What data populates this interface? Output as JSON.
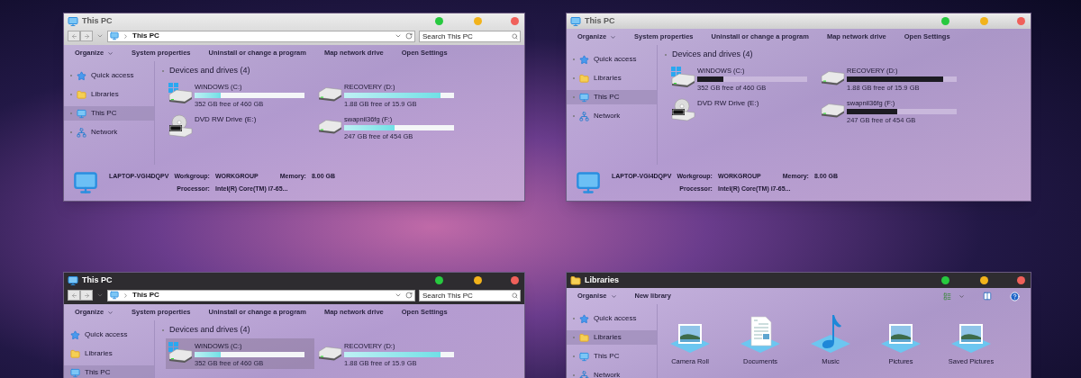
{
  "windows": [
    {
      "title": "This PC",
      "address": {
        "path": "This PC",
        "search_placeholder": "Search This PC"
      },
      "toolbar": [
        {
          "label": "Organize",
          "kind": "menu"
        },
        {
          "label": "System properties",
          "kind": "plain"
        },
        {
          "label": "Uninstall or change a program",
          "kind": "plain"
        },
        {
          "label": "Map network drive",
          "kind": "plain"
        },
        {
          "label": "Open Settings",
          "kind": "plain"
        }
      ],
      "sidebar": [
        {
          "label": "Quick access",
          "kind": "star",
          "selected": false
        },
        {
          "label": "Libraries",
          "kind": "folder",
          "selected": false
        },
        {
          "label": "This PC",
          "kind": "pc",
          "selected": true
        },
        {
          "label": "Network",
          "kind": "network",
          "selected": false
        }
      ],
      "section": "Devices and drives (4)",
      "drives": [
        {
          "name": "WINDOWS (C:)",
          "kind": "hdd_windows",
          "free": "352 GB free of 460 GB",
          "level": 0.24,
          "selected": false
        },
        {
          "name": "RECOVERY (D:)",
          "kind": "hdd",
          "free": "1.88 GB free of 15.9 GB",
          "level": 0.88,
          "selected": false
        },
        {
          "name": "DVD RW Drive (E:)",
          "kind": "dvd",
          "selected": false
        },
        {
          "name": "swapnil36fg (F:)",
          "kind": "hdd",
          "free": "247 GB free of 454 GB",
          "level": 0.46,
          "selected": false
        }
      ],
      "details": {
        "computer": "LAPTOP-VGI4DQPV",
        "workgroup_label": "Workgroup:",
        "workgroup": "WORKGROUP",
        "memory_label": "Memory:",
        "memory": "8.00 GB",
        "processor_label": "Processor:",
        "processor": "Intel(R) Core(TM) i7-65..."
      }
    },
    {
      "title": "This PC",
      "toolbar": [
        {
          "label": "Organize",
          "kind": "menu"
        },
        {
          "label": "System properties",
          "kind": "plain"
        },
        {
          "label": "Uninstall or change a program",
          "kind": "plain"
        },
        {
          "label": "Map network drive",
          "kind": "plain"
        },
        {
          "label": "Open Settings",
          "kind": "plain"
        }
      ],
      "sidebar": [
        {
          "label": "Quick access",
          "kind": "star",
          "selected": false
        },
        {
          "label": "Libraries",
          "kind": "folder",
          "selected": false
        },
        {
          "label": "This PC",
          "kind": "pc",
          "selected": true
        },
        {
          "label": "Network",
          "kind": "network",
          "selected": false
        }
      ],
      "section": "Devices and drives (4)",
      "drives": [
        {
          "name": "WINDOWS (C:)",
          "kind": "hdd_windows",
          "free": "352 GB free of 460 GB",
          "level": 0.24,
          "selected": false
        },
        {
          "name": "RECOVERY (D:)",
          "kind": "hdd",
          "free": "1.88 GB free of 15.9 GB",
          "level": 0.88,
          "selected": false
        },
        {
          "name": "DVD RW Drive (E:)",
          "kind": "dvd",
          "selected": false
        },
        {
          "name": "swapnil36fg (F:)",
          "kind": "hdd",
          "free": "247 GB free of 454 GB",
          "level": 0.46,
          "selected": false
        }
      ],
      "details": {
        "computer": "LAPTOP-VGI4DQPV",
        "workgroup_label": "Workgroup:",
        "workgroup": "WORKGROUP",
        "memory_label": "Memory:",
        "memory": "8.00 GB",
        "processor_label": "Processor:",
        "processor": "Intel(R) Core(TM) i7-65..."
      }
    },
    {
      "title": "This PC",
      "address": {
        "path": "This PC",
        "search_placeholder": "Search This PC"
      },
      "toolbar": [
        {
          "label": "Organize",
          "kind": "menu"
        },
        {
          "label": "System properties",
          "kind": "plain"
        },
        {
          "label": "Uninstall or change a program",
          "kind": "plain"
        },
        {
          "label": "Map network drive",
          "kind": "plain"
        },
        {
          "label": "Open Settings",
          "kind": "plain"
        }
      ],
      "sidebar": [
        {
          "label": "Quick access",
          "kind": "star",
          "selected": false
        },
        {
          "label": "Libraries",
          "kind": "folder",
          "selected": false
        },
        {
          "label": "This PC",
          "kind": "pc",
          "selected": true
        }
      ],
      "section": "Devices and drives (4)",
      "drives": [
        {
          "name": "WINDOWS (C:)",
          "kind": "hdd_windows",
          "free": "352 GB free of 460 GB",
          "level": 0.24,
          "selected": true
        },
        {
          "name": "RECOVERY (D:)",
          "kind": "hdd",
          "free": "1.88 GB free of 15.9 GB",
          "level": 0.88,
          "selected": false
        }
      ]
    },
    {
      "title": "Libraries",
      "toolbar": [
        {
          "label": "Organise",
          "kind": "menu"
        },
        {
          "label": "New library",
          "kind": "plain"
        }
      ],
      "sidebar": [
        {
          "label": "Quick access",
          "kind": "star",
          "selected": false
        },
        {
          "label": "Libraries",
          "kind": "folder",
          "selected": true
        },
        {
          "label": "This PC",
          "kind": "pc",
          "selected": false
        },
        {
          "label": "Network",
          "kind": "network",
          "selected": false
        }
      ],
      "libraries": [
        {
          "label": "Camera Roll",
          "kind": "pictures"
        },
        {
          "label": "Documents",
          "kind": "documents"
        },
        {
          "label": "Music",
          "kind": "music"
        },
        {
          "label": "Pictures",
          "kind": "pictures"
        },
        {
          "label": "Saved Pictures",
          "kind": "pictures"
        }
      ]
    }
  ]
}
